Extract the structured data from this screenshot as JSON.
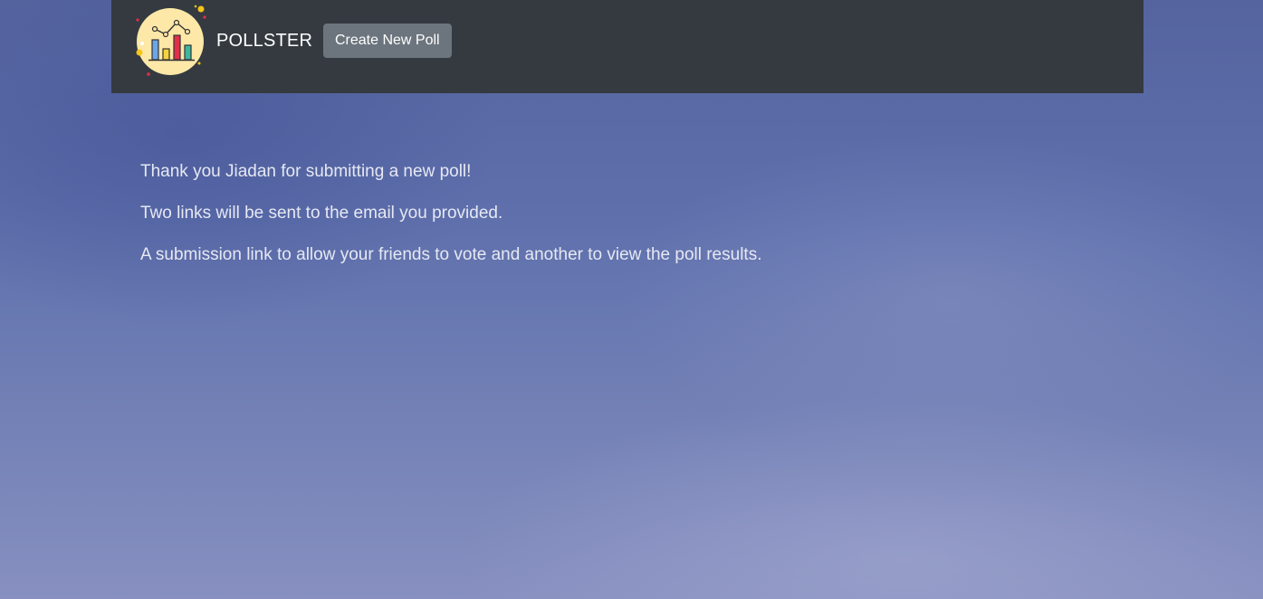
{
  "navbar": {
    "brand": "POLLSTER",
    "logo_icon": "poll-chart-logo-icon",
    "create_button_label": "Create New Poll"
  },
  "main": {
    "lines": [
      "Thank you Jiadan for submitting a new poll!",
      "Two links will be sent to the email you provided.",
      "A submission link to allow your friends to vote and another to view the poll results."
    ]
  },
  "colors": {
    "navbar_bg": "#343a40",
    "button_bg": "#6c757d",
    "logo_circle": "#fde8a8"
  }
}
